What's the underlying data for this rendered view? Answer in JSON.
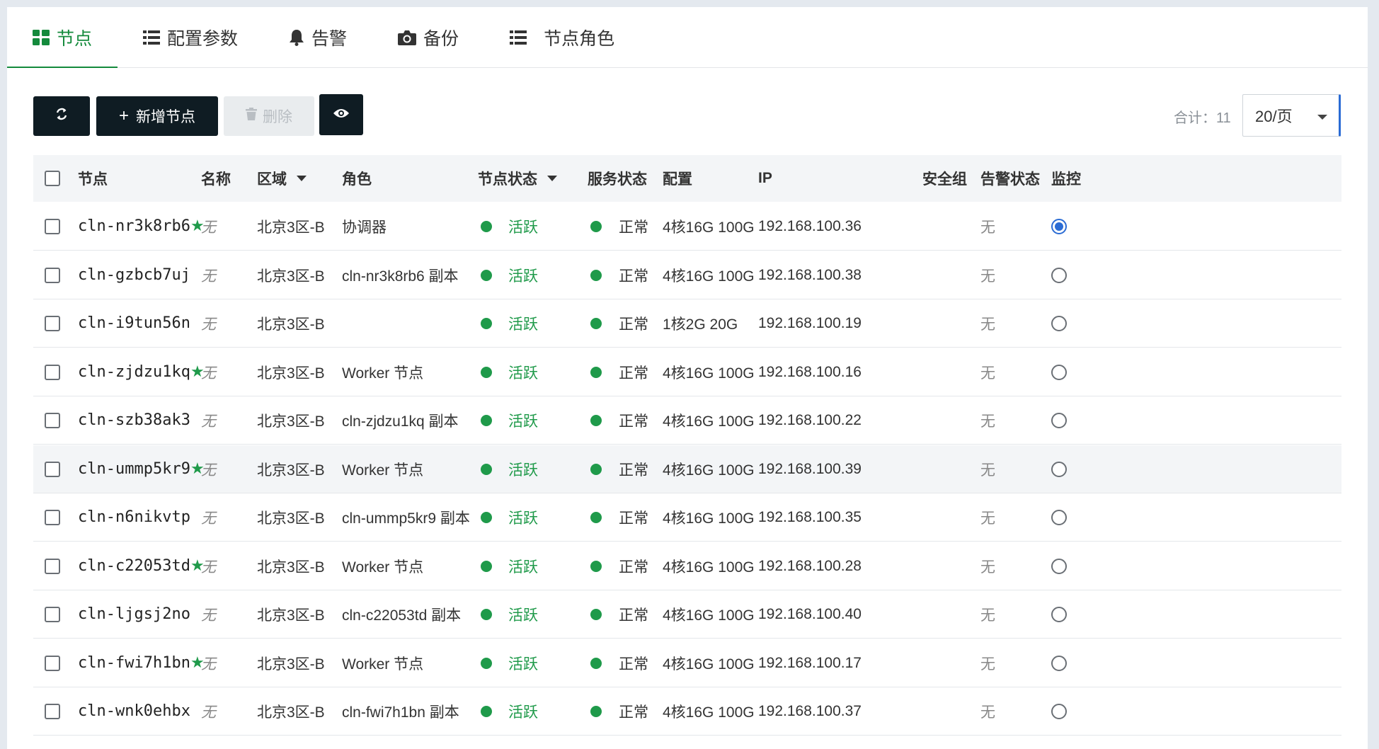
{
  "tabs": [
    {
      "label": "节点",
      "icon": "grid-icon",
      "active": true
    },
    {
      "label": "配置参数",
      "icon": "list-icon",
      "active": false
    },
    {
      "label": "告警",
      "icon": "bell-icon",
      "active": false
    },
    {
      "label": "备份",
      "icon": "camera-icon",
      "active": false
    },
    {
      "label": "节点角色",
      "icon": "list-icon",
      "active": false
    }
  ],
  "toolbar": {
    "refresh_icon": "refresh-icon",
    "add_label": "新增节点",
    "delete_label": "删除",
    "view_icon": "eye-icon"
  },
  "pagination": {
    "total_label": "合计：11",
    "page_size": "20/页"
  },
  "columns": [
    "节点",
    "名称",
    "区域",
    "角色",
    "节点状态",
    "服务状态",
    "配置",
    "IP",
    "安全组",
    "告警状态",
    "监控"
  ],
  "rows": [
    {
      "node": "cln-nr3k8rb6",
      "starred": true,
      "name": "无",
      "zone": "北京3区-B",
      "role": "协调器",
      "node_status": "活跃",
      "service_status": "正常",
      "config": "4核16G 100G",
      "ip": "192.168.100.36",
      "alarm": "无",
      "monitor": true
    },
    {
      "node": "cln-gzbcb7uj",
      "starred": false,
      "name": "无",
      "zone": "北京3区-B",
      "role": "cln-nr3k8rb6 副本",
      "node_status": "活跃",
      "service_status": "正常",
      "config": "4核16G 100G",
      "ip": "192.168.100.38",
      "alarm": "无",
      "monitor": false
    },
    {
      "node": "cln-i9tun56n",
      "starred": false,
      "name": "无",
      "zone": "北京3区-B",
      "role": "",
      "node_status": "活跃",
      "service_status": "正常",
      "config": "1核2G 20G",
      "ip": "192.168.100.19",
      "alarm": "无",
      "monitor": false
    },
    {
      "node": "cln-zjdzu1kq",
      "starred": true,
      "name": "无",
      "zone": "北京3区-B",
      "role": "Worker 节点",
      "node_status": "活跃",
      "service_status": "正常",
      "config": "4核16G 100G",
      "ip": "192.168.100.16",
      "alarm": "无",
      "monitor": false
    },
    {
      "node": "cln-szb38ak3",
      "starred": false,
      "name": "无",
      "zone": "北京3区-B",
      "role": "cln-zjdzu1kq 副本",
      "node_status": "活跃",
      "service_status": "正常",
      "config": "4核16G 100G",
      "ip": "192.168.100.22",
      "alarm": "无",
      "monitor": false
    },
    {
      "node": "cln-ummp5kr9",
      "starred": true,
      "name": "无",
      "zone": "北京3区-B",
      "role": "Worker 节点",
      "node_status": "活跃",
      "service_status": "正常",
      "config": "4核16G 100G",
      "ip": "192.168.100.39",
      "alarm": "无",
      "monitor": false
    },
    {
      "node": "cln-n6nikvtp",
      "starred": false,
      "name": "无",
      "zone": "北京3区-B",
      "role": "cln-ummp5kr9 副本",
      "node_status": "活跃",
      "service_status": "正常",
      "config": "4核16G 100G",
      "ip": "192.168.100.35",
      "alarm": "无",
      "monitor": false
    },
    {
      "node": "cln-c22053td",
      "starred": true,
      "name": "无",
      "zone": "北京3区-B",
      "role": "Worker 节点",
      "node_status": "活跃",
      "service_status": "正常",
      "config": "4核16G 100G",
      "ip": "192.168.100.28",
      "alarm": "无",
      "monitor": false
    },
    {
      "node": "cln-ljgsj2no",
      "starred": false,
      "name": "无",
      "zone": "北京3区-B",
      "role": "cln-c22053td 副本",
      "node_status": "活跃",
      "service_status": "正常",
      "config": "4核16G 100G",
      "ip": "192.168.100.40",
      "alarm": "无",
      "monitor": false
    },
    {
      "node": "cln-fwi7h1bn",
      "starred": true,
      "name": "无",
      "zone": "北京3区-B",
      "role": "Worker 节点",
      "node_status": "活跃",
      "service_status": "正常",
      "config": "4核16G 100G",
      "ip": "192.168.100.17",
      "alarm": "无",
      "monitor": false
    },
    {
      "node": "cln-wnk0ehbx",
      "starred": false,
      "name": "无",
      "zone": "北京3区-B",
      "role": "cln-fwi7h1bn 副本",
      "node_status": "活跃",
      "service_status": "正常",
      "config": "4核16G 100G",
      "ip": "192.168.100.37",
      "alarm": "无",
      "monitor": false
    }
  ],
  "colors": {
    "accent": "#148a3c",
    "status_green": "#1f9a4a",
    "dark_button": "#0f1c23",
    "radio_blue": "#2b6cd4"
  }
}
